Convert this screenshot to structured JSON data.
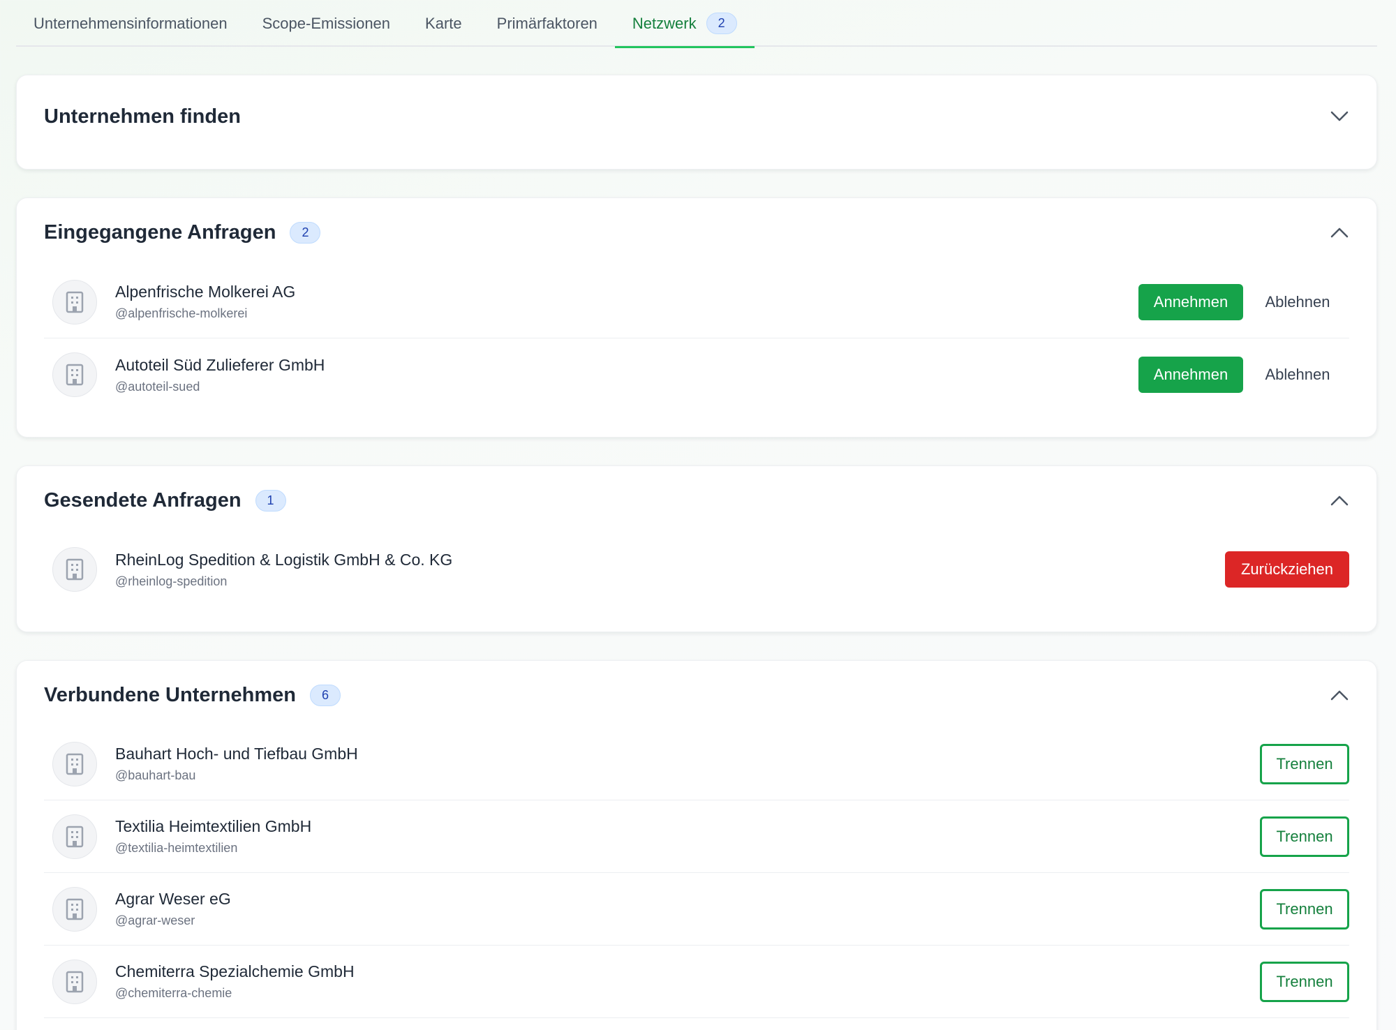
{
  "tabs": [
    {
      "label": "Unternehmensinformationen"
    },
    {
      "label": "Scope-Emissionen"
    },
    {
      "label": "Karte"
    },
    {
      "label": "Primärfaktoren"
    },
    {
      "label": "Netzwerk",
      "badge": "2",
      "active": true
    }
  ],
  "find": {
    "title": "Unternehmen finden",
    "icon": "chevron-down-icon"
  },
  "incoming": {
    "title": "Eingegangene Anfragen",
    "count": "2",
    "accept_label": "Annehmen",
    "decline_label": "Ablehnen",
    "items": [
      {
        "name": "Alpenfrische Molkerei AG",
        "handle": "@alpenfrische-molkerei"
      },
      {
        "name": "Autoteil Süd Zulieferer GmbH",
        "handle": "@autoteil-sued"
      }
    ]
  },
  "sent": {
    "title": "Gesendete Anfragen",
    "count": "1",
    "withdraw_label": "Zurückziehen",
    "items": [
      {
        "name": "RheinLog Spedition & Logistik GmbH & Co. KG",
        "handle": "@rheinlog-spedition"
      }
    ]
  },
  "connected": {
    "title": "Verbundene Unternehmen",
    "count": "6",
    "disconnect_label": "Trennen",
    "items": [
      {
        "name": "Bauhart Hoch- und Tiefbau GmbH",
        "handle": "@bauhart-bau"
      },
      {
        "name": "Textilia Heimtextilien GmbH",
        "handle": "@textilia-heimtextilien"
      },
      {
        "name": "Agrar Weser eG",
        "handle": "@agrar-weser"
      },
      {
        "name": "Chemiterra Spezialchemie GmbH",
        "handle": "@chemiterra-chemie"
      }
    ]
  },
  "colors": {
    "accent": "#16a34a",
    "danger": "#dc2626",
    "badge_bg": "#dbeafe",
    "badge_text": "#1e40af"
  }
}
